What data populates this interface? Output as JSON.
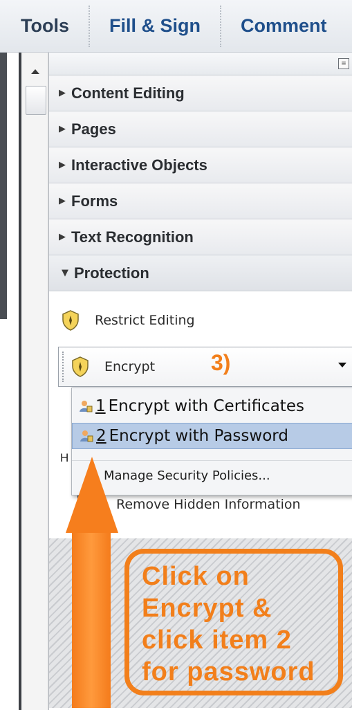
{
  "toolbar": {
    "tabs": [
      {
        "label": "Tools"
      },
      {
        "label": "Fill & Sign"
      },
      {
        "label": "Comment"
      }
    ]
  },
  "panel": {
    "sections": [
      {
        "label": "Content Editing",
        "expanded": false
      },
      {
        "label": "Pages",
        "expanded": false
      },
      {
        "label": "Interactive Objects",
        "expanded": false
      },
      {
        "label": "Forms",
        "expanded": false
      },
      {
        "label": "Text Recognition",
        "expanded": false
      },
      {
        "label": "Protection",
        "expanded": true
      }
    ],
    "protection_tools": {
      "restrict_editing": "Restrict Editing",
      "encrypt": "Encrypt",
      "hidden_heading_letter": "H",
      "remove_hidden": "Remove Hidden Information"
    },
    "encrypt_menu": {
      "items": [
        {
          "num": "1",
          "label": "Encrypt with Certificates",
          "highlighted": false
        },
        {
          "num": "2",
          "label": "Encrypt with Password",
          "highlighted": true
        }
      ],
      "manage": "Manage Security Policies..."
    }
  },
  "annotation": {
    "step": "3)",
    "callout_lines": [
      "Click on",
      "Encrypt &",
      "click item 2",
      "for password"
    ],
    "color": "#f27f1b"
  }
}
